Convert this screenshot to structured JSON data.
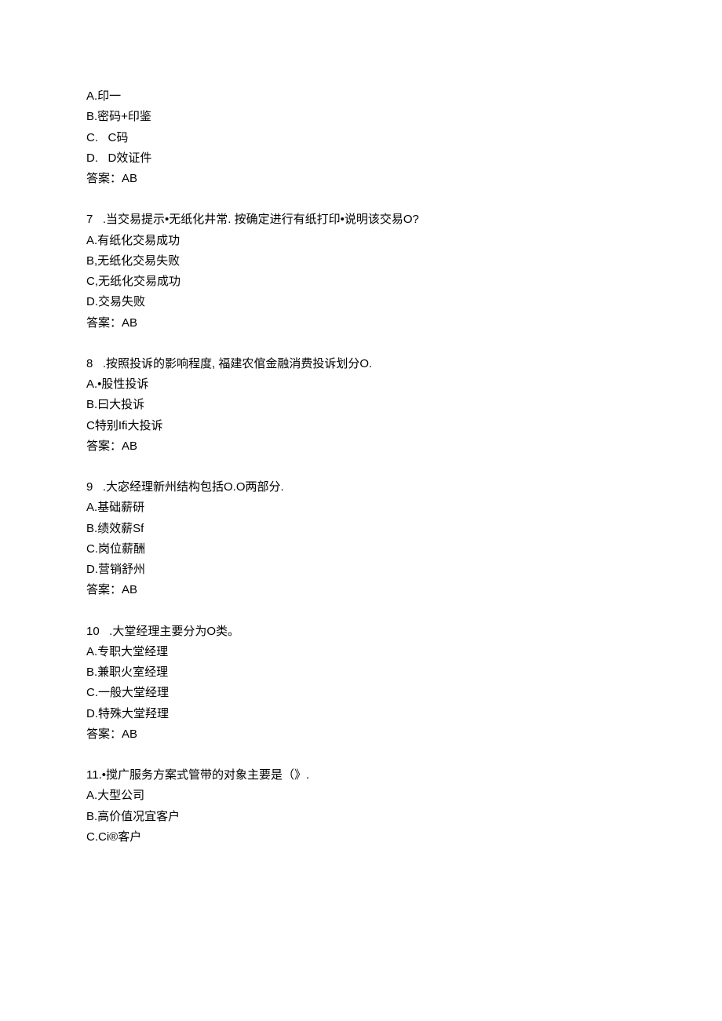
{
  "q6": {
    "optA": "A.印一",
    "optB": "B.密码+印鉴",
    "optC": "C.   C码",
    "optD": "D.   D效证件",
    "ans": "答案：AB"
  },
  "q7": {
    "stem": "7   .当交易提示•无纸化井常. 按确定进行有纸打印•说明该交易O?",
    "optA": "A.有纸化交易成功",
    "optB": "B,无纸化交易失败",
    "optC": "C,无纸化交易成功",
    "optD": "D.交易失败",
    "ans": "答案：AB"
  },
  "q8": {
    "stem": "8   .按照投诉的影响程度, 福建农倌金融消费投诉划分O.",
    "optA": "A.•股性投诉",
    "optB": "B.曰大投诉",
    "optC": "C特别Ifi大投诉",
    "ans": "答案：AB"
  },
  "q9": {
    "stem": "9   .大宓经理新州结构包括O.O两部分.",
    "optA": "A.基础薪研",
    "optB": "B.绩效薪Sf",
    "optC": "C.岗位薪酬",
    "optD": "D.营销舒州",
    "ans": "答案：AB"
  },
  "q10": {
    "stem": "10   .大堂经理主要分为O类。",
    "optA": "A.专职大堂经理",
    "optB": "B.兼职火室经理",
    "optC": "C.一般大堂经理",
    "optD": "D.特殊大堂羟理",
    "ans": "答案：AB"
  },
  "q11": {
    "stem": "11.•搅广服务方案式管带的对象主要是（》.",
    "optA": "A.大型公司",
    "optB": "B.高价值况宜客户",
    "optC": "C.Ci®客户"
  }
}
